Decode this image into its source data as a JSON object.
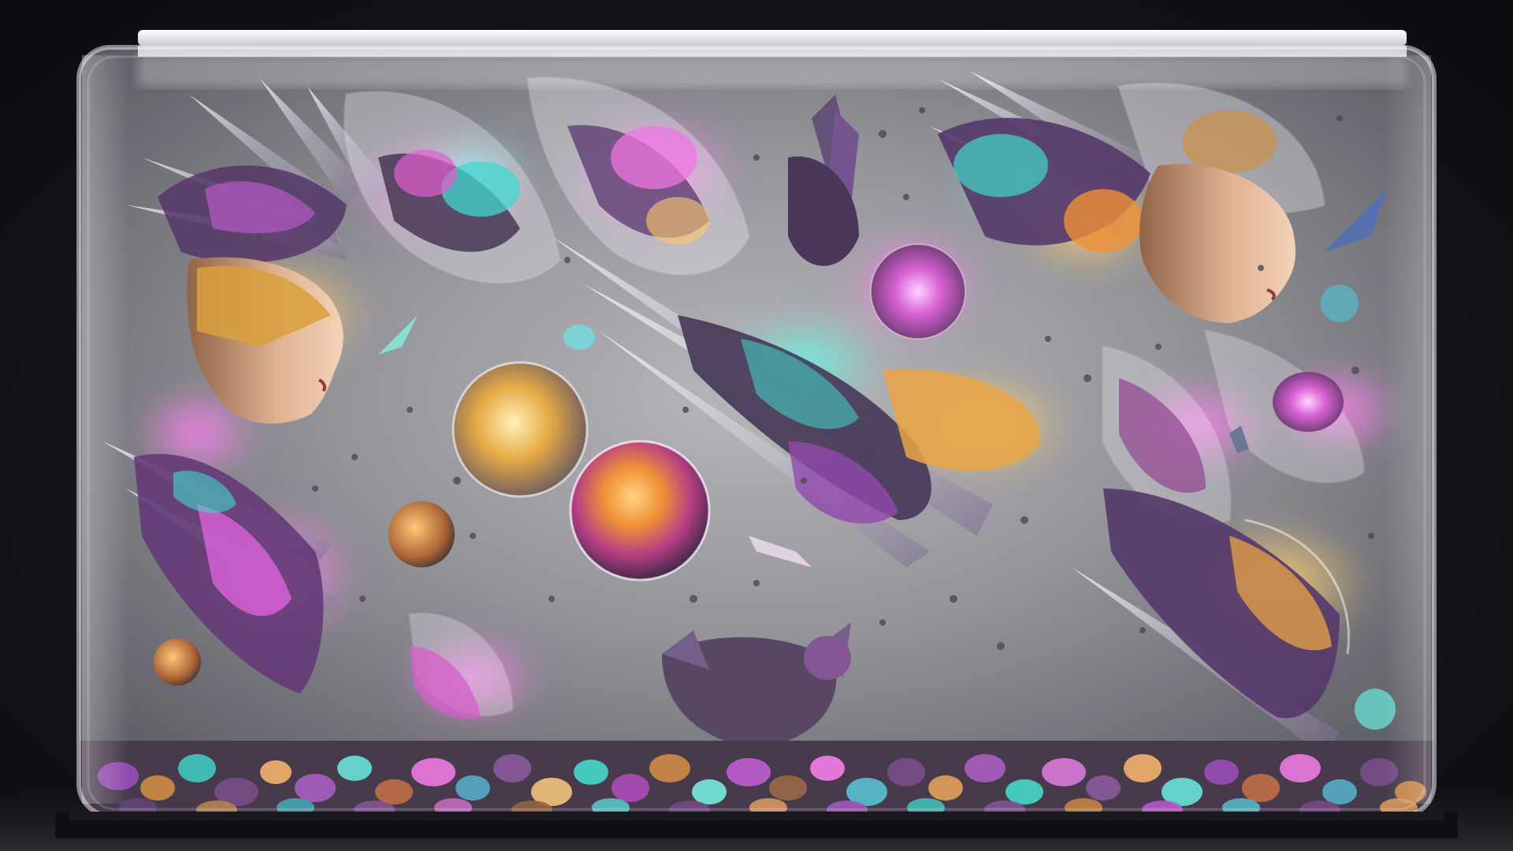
{
  "image": {
    "subject": "aquarium-tank",
    "palette": {
      "background": "#101216",
      "water_mist": "#8f9196",
      "amethyst": "#8a3fa8",
      "magenta": "#e04bd6",
      "teal": "#35d6c8",
      "amber": "#f0a035",
      "glass_highlight": "#ffffff",
      "tank_frame": "#1a1b1f"
    }
  }
}
